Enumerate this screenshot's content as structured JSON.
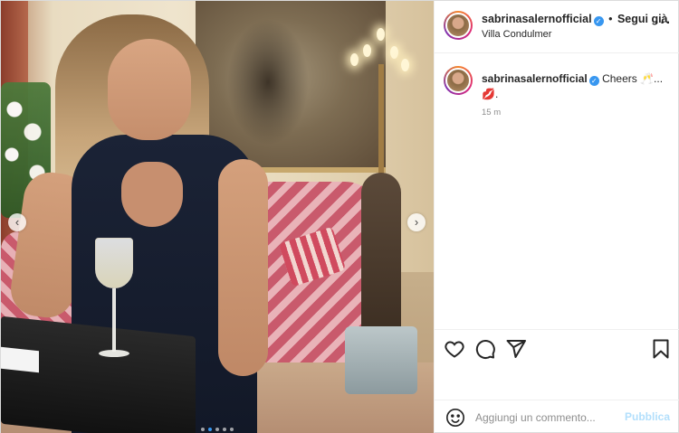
{
  "header": {
    "username": "sabrinasalernofficial",
    "separator": "•",
    "follow_label": "Segui già",
    "location": "Villa Condulmer",
    "more_label": "···"
  },
  "caption": {
    "username": "sabrinasalernofficial",
    "text": "Cheers 🥂...",
    "emoji_line": "💋.",
    "time": "15 m"
  },
  "carousel": {
    "prev_label": "‹",
    "next_label": "›",
    "slide_count": 5,
    "active_slide": 2
  },
  "add_comment": {
    "placeholder": "Aggiungi un commento...",
    "publish_label": "Pubblica"
  },
  "icons": [
    "verified-badge-icon",
    "more-options-icon",
    "heart-icon",
    "comment-icon",
    "share-icon",
    "bookmark-icon",
    "emoji-icon",
    "chevron-left-icon",
    "chevron-right-icon"
  ],
  "colors": {
    "verified": "#3897f0",
    "publish_disabled": "#b2dffc",
    "muted_text": "#8e8e8e",
    "active_dot": "#3897f0"
  }
}
